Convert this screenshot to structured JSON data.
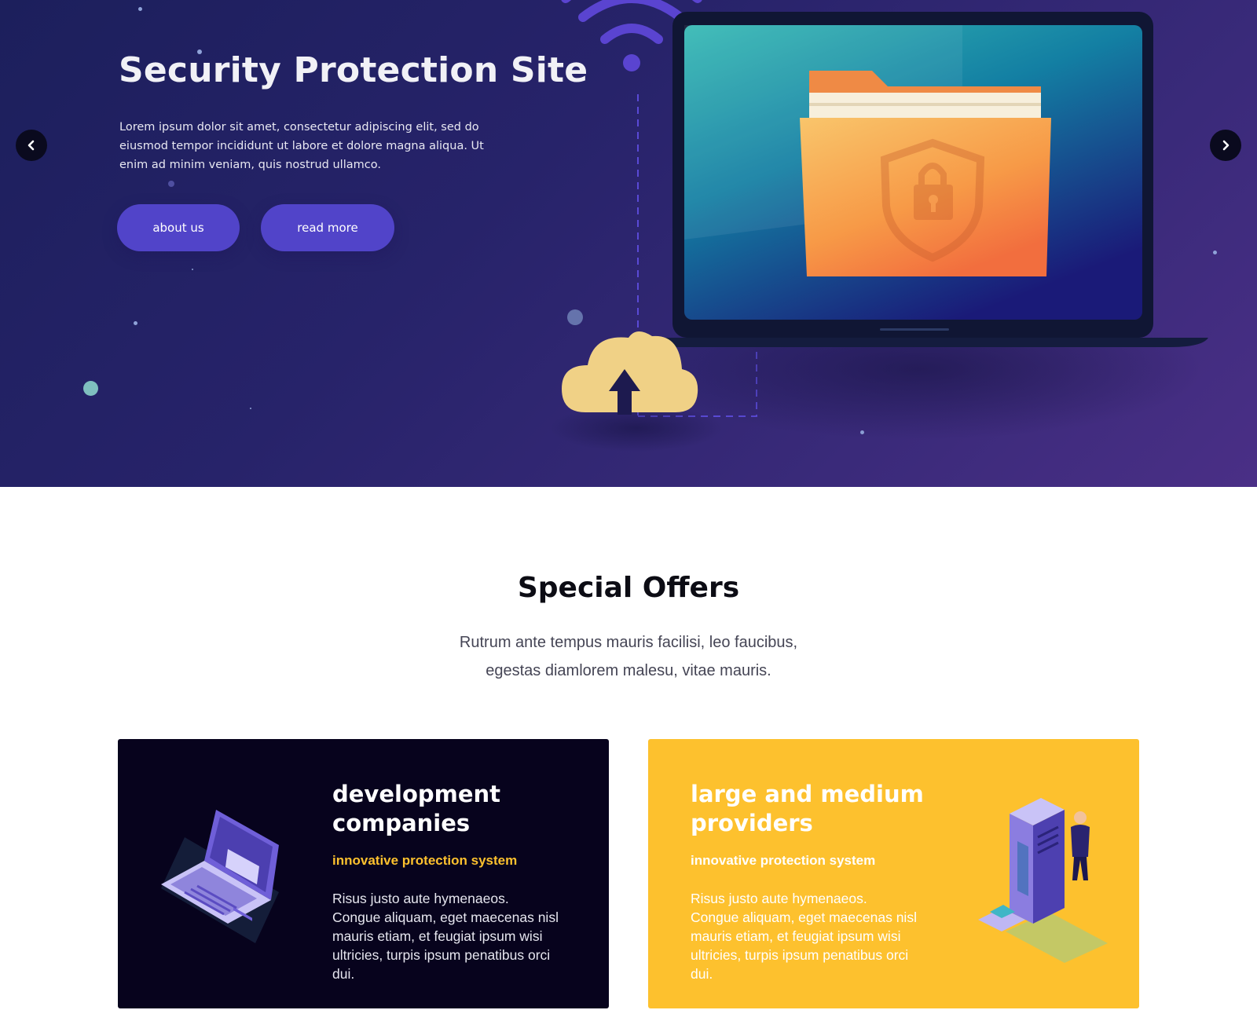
{
  "hero": {
    "title": "Security Protection Site",
    "text": "Lorem ipsum dolor sit amet, consectetur adipiscing elit, sed do eiusmod tempor incididunt ut labore et dolore magna aliqua. Ut enim ad minim veniam, quis nostrud ullamco.",
    "buttons": {
      "about": "about us",
      "read_more": "read more"
    },
    "arrows": {
      "prev_icon": "chevron-left-icon",
      "next_icon": "chevron-right-icon"
    },
    "illustration": "laptop-with-locked-folder-illustration"
  },
  "offers": {
    "title": "Special Offers",
    "subtitle_line1": "Rutrum ante tempus mauris facilisi, leo faucibus,",
    "subtitle_line2": "egestas diamlorem malesu, vitae mauris.",
    "cards": [
      {
        "title_line1": "development",
        "title_line2": "companies",
        "tag": "innovative protection system",
        "text": "Risus justo aute hymenaeos. Congue aliquam, eget maecenas nisl mauris etiam, et feugiat ipsum wisi ultricies, turpis ipsum penatibus orci dui.",
        "illustration": "laptop-login-illustration",
        "background": "#07031d"
      },
      {
        "title_line1": "large and medium",
        "title_line2": "providers",
        "tag": "innovative protection system",
        "text": "Risus justo aute hymenaeos. Congue aliquam, eget maecenas nisl mauris etiam, et feugiat ipsum wisi ultricies, turpis ipsum penatibus orci dui.",
        "illustration": "server-with-person-illustration",
        "background": "#fdc12e"
      }
    ]
  },
  "colors": {
    "hero_gradient_start": "#1c1f5c",
    "hero_gradient_end": "#4a2f86",
    "button": "#5144c9",
    "accent_yellow": "#fdc12e",
    "dark_card": "#07031d"
  }
}
